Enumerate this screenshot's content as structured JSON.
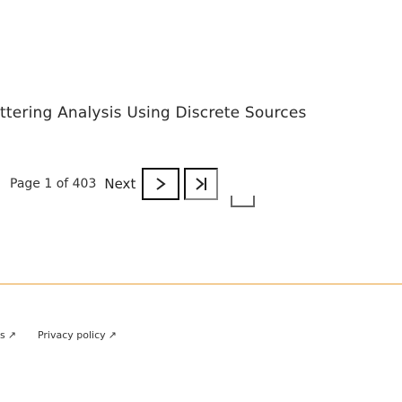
{
  "header": {
    "title": "ttering Analysis Using Discrete Sources"
  },
  "pager": {
    "page_info": "Page 1 of 403",
    "next_label": "Next",
    "next_button_glyph": ">",
    "last_button_glyph": ">|"
  },
  "footer": {
    "links": [
      {
        "label": "s",
        "icon": "external-link-icon"
      },
      {
        "label": "Privacy policy",
        "icon": "external-link-icon"
      }
    ]
  },
  "colors": {
    "divider": "#e9a23b",
    "button_border": "#111111"
  }
}
